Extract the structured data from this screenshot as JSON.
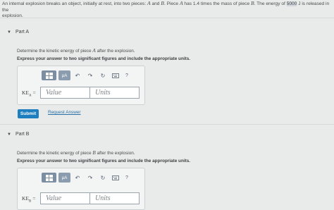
{
  "problem": {
    "t1": "An internal explosion breaks an object, initially at rest, into two pieces: ",
    "a": "A",
    "t2": " and ",
    "b": "B",
    "t3": ". Piece ",
    "a2": "A",
    "t4": " has 1.4 times the mass of piece ",
    "b2": "B",
    "t5": ". The energy of ",
    "energy": "5000",
    "t6": " J is released in the",
    "line2": "explosion."
  },
  "partA": {
    "title": "Part A",
    "q_prefix": "Determine the kinetic energy of piece ",
    "q_var": "A",
    "q_suffix": " after the explosion.",
    "instruction": "Express your answer to two significant figures and include the appropriate units.",
    "var_label": "KE",
    "var_sub": "A",
    "var_eq": " =",
    "value_placeholder": "Value",
    "units_placeholder": "Units",
    "submit_label": "Submit",
    "request_label": "Request Answer"
  },
  "partB": {
    "title": "Part B",
    "q_prefix": "Determine the kinetic energy of piece ",
    "q_var": "B",
    "q_suffix": " after the explosion.",
    "instruction": "Express your answer to two significant figures and include the appropriate units.",
    "var_label": "KE",
    "var_sub": "B",
    "var_eq": " =",
    "value_placeholder": "Value",
    "units_placeholder": "Units"
  },
  "toolbar": {
    "mu_label": "μA",
    "undo_glyph": "↶",
    "redo_glyph": "↷",
    "reset_glyph": "↻",
    "help_label": "?",
    "icons": [
      "templates-icon",
      "units-icon",
      "undo-icon",
      "redo-icon",
      "reset-icon",
      "keyboard-icon",
      "help-icon"
    ]
  },
  "colors": {
    "background": "#e9ebeb",
    "submit": "#1d7ec0",
    "link": "#2a6fa6",
    "toolbar_button": "#7c8fa2"
  }
}
